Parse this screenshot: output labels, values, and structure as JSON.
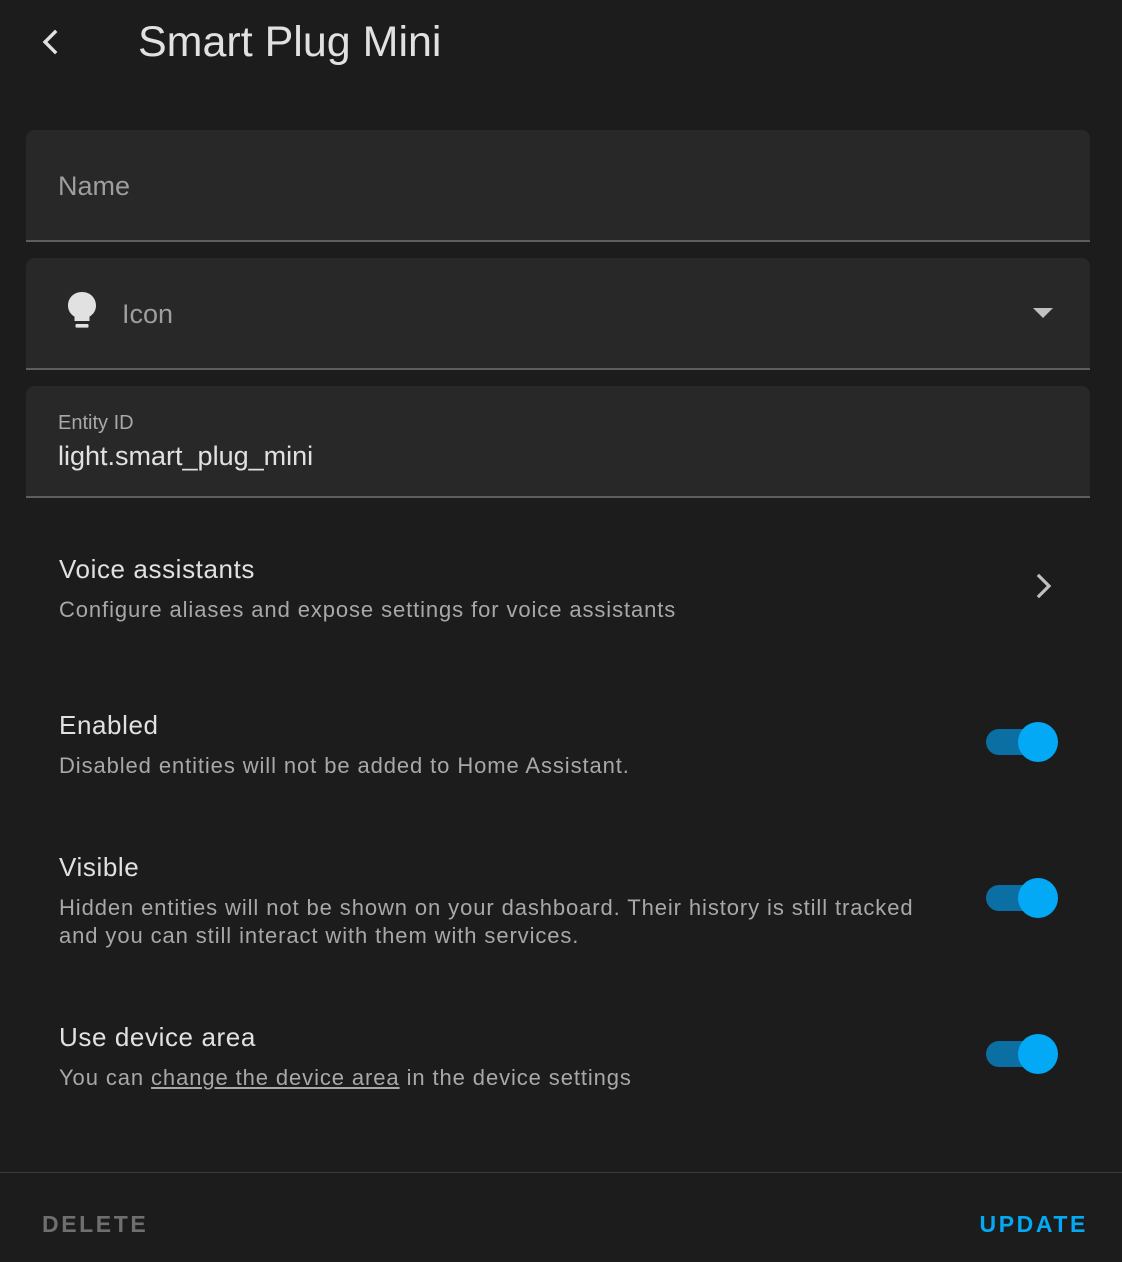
{
  "header": {
    "back_icon": "chevron-left-icon",
    "title": "Smart Plug Mini"
  },
  "form": {
    "name": {
      "placeholder": "Name",
      "value": ""
    },
    "icon": {
      "placeholder": "Icon",
      "leading_icon": "lightbulb-icon",
      "trailing_icon": "dropdown-arrow-icon"
    },
    "entity_id": {
      "label": "Entity ID",
      "value": "light.smart_plug_mini"
    }
  },
  "settings": {
    "voice": {
      "title": "Voice assistants",
      "description": "Configure aliases and expose settings for voice assistants",
      "icon": "chevron-right-icon"
    },
    "enabled": {
      "title": "Enabled",
      "description": "Disabled entities will not be added to Home Assistant.",
      "checked": true
    },
    "visible": {
      "title": "Visible",
      "description": "Hidden entities will not be shown on your dashboard. Their history is still tracked and you can still interact with them with services.",
      "checked": true
    },
    "device_area": {
      "title": "Use device area",
      "description_prefix": "You can ",
      "link_text": "change the device area",
      "description_suffix": " in the device settings",
      "checked": true
    }
  },
  "footer": {
    "delete_label": "DELETE",
    "update_label": "UPDATE"
  },
  "colors": {
    "background": "#1c1c1c",
    "field_background": "#282828",
    "accent": "#03a9f4",
    "toggle_track": "#0b6fa3",
    "disabled_text": "#6f6f6f"
  }
}
